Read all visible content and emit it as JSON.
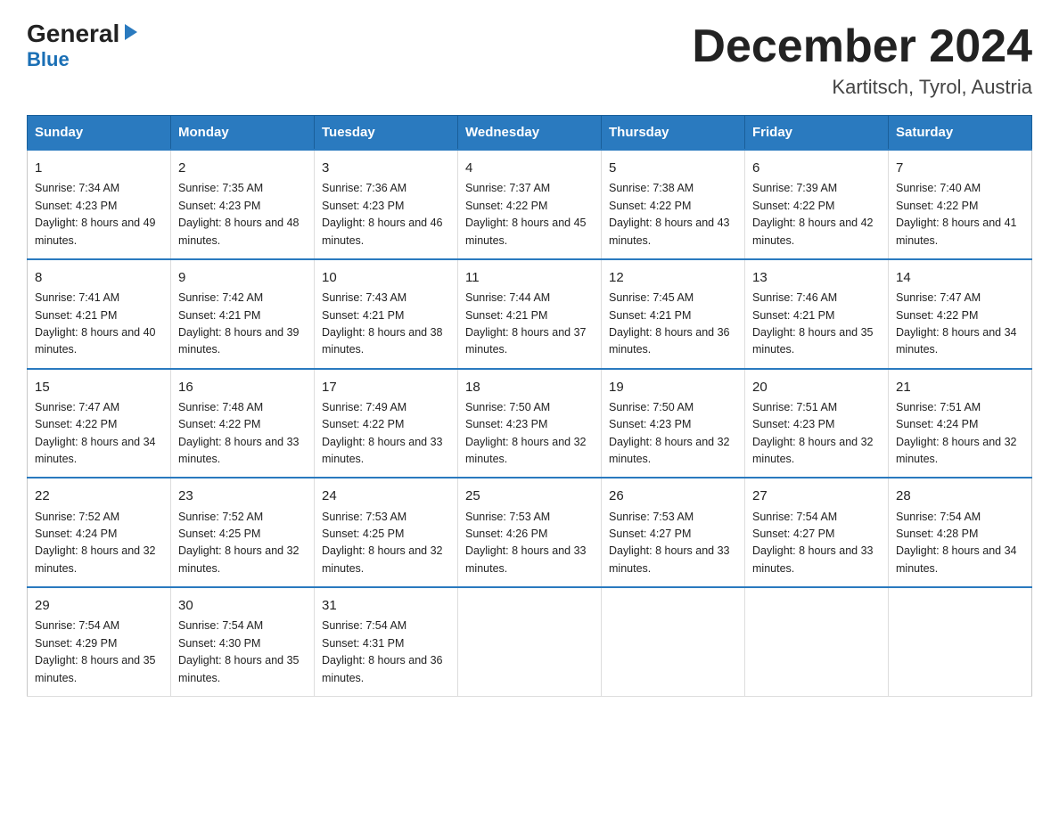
{
  "logo": {
    "general": "General",
    "blue": "Blue",
    "arrow": "▶"
  },
  "header": {
    "month_title": "December 2024",
    "location": "Kartitsch, Tyrol, Austria"
  },
  "days_of_week": [
    "Sunday",
    "Monday",
    "Tuesday",
    "Wednesday",
    "Thursday",
    "Friday",
    "Saturday"
  ],
  "weeks": [
    [
      {
        "day": "1",
        "sunrise": "7:34 AM",
        "sunset": "4:23 PM",
        "daylight": "8 hours and 49 minutes."
      },
      {
        "day": "2",
        "sunrise": "7:35 AM",
        "sunset": "4:23 PM",
        "daylight": "8 hours and 48 minutes."
      },
      {
        "day": "3",
        "sunrise": "7:36 AM",
        "sunset": "4:23 PM",
        "daylight": "8 hours and 46 minutes."
      },
      {
        "day": "4",
        "sunrise": "7:37 AM",
        "sunset": "4:22 PM",
        "daylight": "8 hours and 45 minutes."
      },
      {
        "day": "5",
        "sunrise": "7:38 AM",
        "sunset": "4:22 PM",
        "daylight": "8 hours and 43 minutes."
      },
      {
        "day": "6",
        "sunrise": "7:39 AM",
        "sunset": "4:22 PM",
        "daylight": "8 hours and 42 minutes."
      },
      {
        "day": "7",
        "sunrise": "7:40 AM",
        "sunset": "4:22 PM",
        "daylight": "8 hours and 41 minutes."
      }
    ],
    [
      {
        "day": "8",
        "sunrise": "7:41 AM",
        "sunset": "4:21 PM",
        "daylight": "8 hours and 40 minutes."
      },
      {
        "day": "9",
        "sunrise": "7:42 AM",
        "sunset": "4:21 PM",
        "daylight": "8 hours and 39 minutes."
      },
      {
        "day": "10",
        "sunrise": "7:43 AM",
        "sunset": "4:21 PM",
        "daylight": "8 hours and 38 minutes."
      },
      {
        "day": "11",
        "sunrise": "7:44 AM",
        "sunset": "4:21 PM",
        "daylight": "8 hours and 37 minutes."
      },
      {
        "day": "12",
        "sunrise": "7:45 AM",
        "sunset": "4:21 PM",
        "daylight": "8 hours and 36 minutes."
      },
      {
        "day": "13",
        "sunrise": "7:46 AM",
        "sunset": "4:21 PM",
        "daylight": "8 hours and 35 minutes."
      },
      {
        "day": "14",
        "sunrise": "7:47 AM",
        "sunset": "4:22 PM",
        "daylight": "8 hours and 34 minutes."
      }
    ],
    [
      {
        "day": "15",
        "sunrise": "7:47 AM",
        "sunset": "4:22 PM",
        "daylight": "8 hours and 34 minutes."
      },
      {
        "day": "16",
        "sunrise": "7:48 AM",
        "sunset": "4:22 PM",
        "daylight": "8 hours and 33 minutes."
      },
      {
        "day": "17",
        "sunrise": "7:49 AM",
        "sunset": "4:22 PM",
        "daylight": "8 hours and 33 minutes."
      },
      {
        "day": "18",
        "sunrise": "7:50 AM",
        "sunset": "4:23 PM",
        "daylight": "8 hours and 32 minutes."
      },
      {
        "day": "19",
        "sunrise": "7:50 AM",
        "sunset": "4:23 PM",
        "daylight": "8 hours and 32 minutes."
      },
      {
        "day": "20",
        "sunrise": "7:51 AM",
        "sunset": "4:23 PM",
        "daylight": "8 hours and 32 minutes."
      },
      {
        "day": "21",
        "sunrise": "7:51 AM",
        "sunset": "4:24 PM",
        "daylight": "8 hours and 32 minutes."
      }
    ],
    [
      {
        "day": "22",
        "sunrise": "7:52 AM",
        "sunset": "4:24 PM",
        "daylight": "8 hours and 32 minutes."
      },
      {
        "day": "23",
        "sunrise": "7:52 AM",
        "sunset": "4:25 PM",
        "daylight": "8 hours and 32 minutes."
      },
      {
        "day": "24",
        "sunrise": "7:53 AM",
        "sunset": "4:25 PM",
        "daylight": "8 hours and 32 minutes."
      },
      {
        "day": "25",
        "sunrise": "7:53 AM",
        "sunset": "4:26 PM",
        "daylight": "8 hours and 33 minutes."
      },
      {
        "day": "26",
        "sunrise": "7:53 AM",
        "sunset": "4:27 PM",
        "daylight": "8 hours and 33 minutes."
      },
      {
        "day": "27",
        "sunrise": "7:54 AM",
        "sunset": "4:27 PM",
        "daylight": "8 hours and 33 minutes."
      },
      {
        "day": "28",
        "sunrise": "7:54 AM",
        "sunset": "4:28 PM",
        "daylight": "8 hours and 34 minutes."
      }
    ],
    [
      {
        "day": "29",
        "sunrise": "7:54 AM",
        "sunset": "4:29 PM",
        "daylight": "8 hours and 35 minutes."
      },
      {
        "day": "30",
        "sunrise": "7:54 AM",
        "sunset": "4:30 PM",
        "daylight": "8 hours and 35 minutes."
      },
      {
        "day": "31",
        "sunrise": "7:54 AM",
        "sunset": "4:31 PM",
        "daylight": "8 hours and 36 minutes."
      },
      null,
      null,
      null,
      null
    ]
  ]
}
